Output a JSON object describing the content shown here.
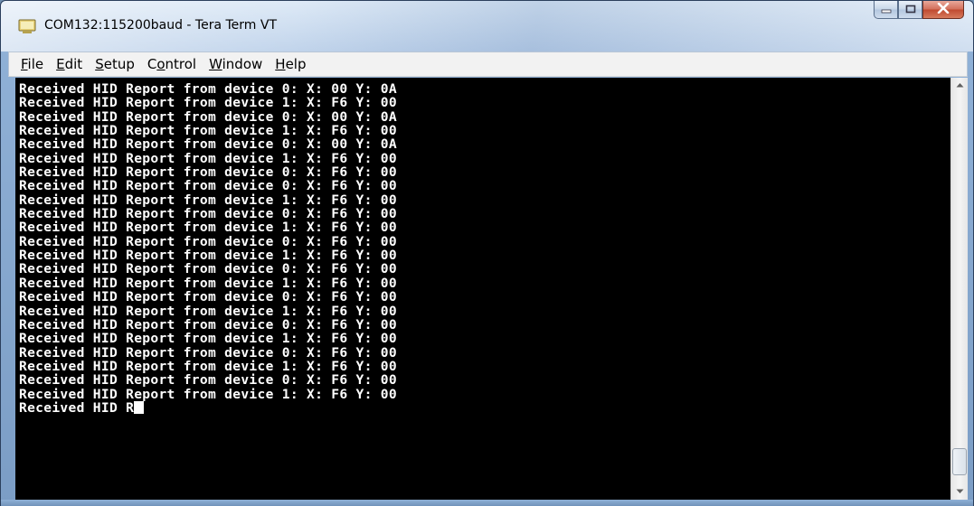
{
  "window": {
    "title": "COM132:115200baud - Tera Term VT"
  },
  "menu": [
    {
      "label": "File",
      "mnemonic": "F",
      "rest": "ile"
    },
    {
      "label": "Edit",
      "mnemonic": "E",
      "rest": "dit"
    },
    {
      "label": "Setup",
      "mnemonic": "S",
      "rest": "etup"
    },
    {
      "label": "Control",
      "pre": "C",
      "mnemonic": "o",
      "rest": "ntrol"
    },
    {
      "label": "Window",
      "mnemonic": "W",
      "rest": "indow"
    },
    {
      "label": "Help",
      "mnemonic": "H",
      "rest": "elp"
    }
  ],
  "terminal": {
    "lines": [
      "Received HID Report from device 0: X: 00 Y: 0A",
      "Received HID Report from device 1: X: F6 Y: 00",
      "Received HID Report from device 0: X: 00 Y: 0A",
      "Received HID Report from device 1: X: F6 Y: 00",
      "Received HID Report from device 0: X: 00 Y: 0A",
      "Received HID Report from device 1: X: F6 Y: 00",
      "Received HID Report from device 0: X: F6 Y: 00",
      "Received HID Report from device 0: X: F6 Y: 00",
      "Received HID Report from device 1: X: F6 Y: 00",
      "Received HID Report from device 0: X: F6 Y: 00",
      "Received HID Report from device 1: X: F6 Y: 00",
      "Received HID Report from device 0: X: F6 Y: 00",
      "Received HID Report from device 1: X: F6 Y: 00",
      "Received HID Report from device 0: X: F6 Y: 00",
      "Received HID Report from device 1: X: F6 Y: 00",
      "Received HID Report from device 0: X: F6 Y: 00",
      "Received HID Report from device 1: X: F6 Y: 00",
      "Received HID Report from device 0: X: F6 Y: 00",
      "Received HID Report from device 1: X: F6 Y: 00",
      "Received HID Report from device 0: X: F6 Y: 00",
      "Received HID Report from device 1: X: F6 Y: 00",
      "Received HID Report from device 0: X: F6 Y: 00",
      "Received HID Report from device 1: X: F6 Y: 00"
    ],
    "current_line": "Received HID R",
    "foreground": "#ffffff",
    "background": "#000000"
  },
  "icons": {
    "app": "tera-term-icon",
    "minimize": "minimize-icon",
    "maximize": "maximize-icon",
    "close": "close-icon",
    "scroll_up": "scroll-up-arrow-icon",
    "scroll_down": "scroll-down-arrow-icon"
  }
}
